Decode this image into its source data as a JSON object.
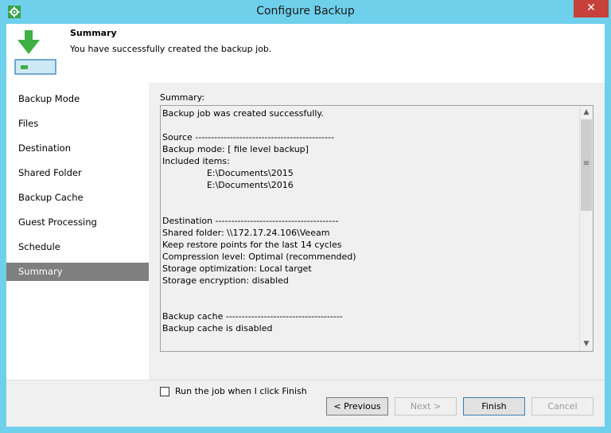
{
  "window": {
    "title": "Configure Backup",
    "close_glyph": "✕"
  },
  "header": {
    "title": "Summary",
    "subtitle": "You have successfully created the backup job."
  },
  "nav": {
    "items": [
      {
        "label": "Backup Mode"
      },
      {
        "label": "Files"
      },
      {
        "label": "Destination"
      },
      {
        "label": "Shared Folder"
      },
      {
        "label": "Backup Cache"
      },
      {
        "label": "Guest Processing"
      },
      {
        "label": "Schedule"
      },
      {
        "label": "Summary",
        "active": true
      }
    ]
  },
  "summary": {
    "label": "Summary:",
    "text": "Backup job was created successfully.\n\nSource --------------------------------------------\nBackup mode: [ file level backup]\nIncluded items:\n                E:\\Documents\\2015\n                E:\\Documents\\2016\n\n\nDestination ---------------------------------------\nShared folder: \\\\172.17.24.106\\Veeam\nKeep restore points for the last 14 cycles\nCompression level: Optimal (recommended)\nStorage optimization: Local target\nStorage encryption: disabled\n\n\nBackup cache -------------------------------------\nBackup cache is disabled"
  },
  "run_job": {
    "label": "Run the job when I click Finish",
    "checked": false
  },
  "buttons": {
    "previous": "< Previous",
    "next": "Next >",
    "finish": "Finish",
    "cancel": "Cancel"
  },
  "colors": {
    "titlebar": "#6fd0ec",
    "close": "#c7413b",
    "active_nav": "#7f7f7f",
    "arrow_green": "#3cb043"
  },
  "icons": {
    "app": "gear-icon",
    "header": "download-arrow-icon",
    "scroll_up": "chevron-up-icon",
    "scroll_down": "chevron-down-icon"
  }
}
